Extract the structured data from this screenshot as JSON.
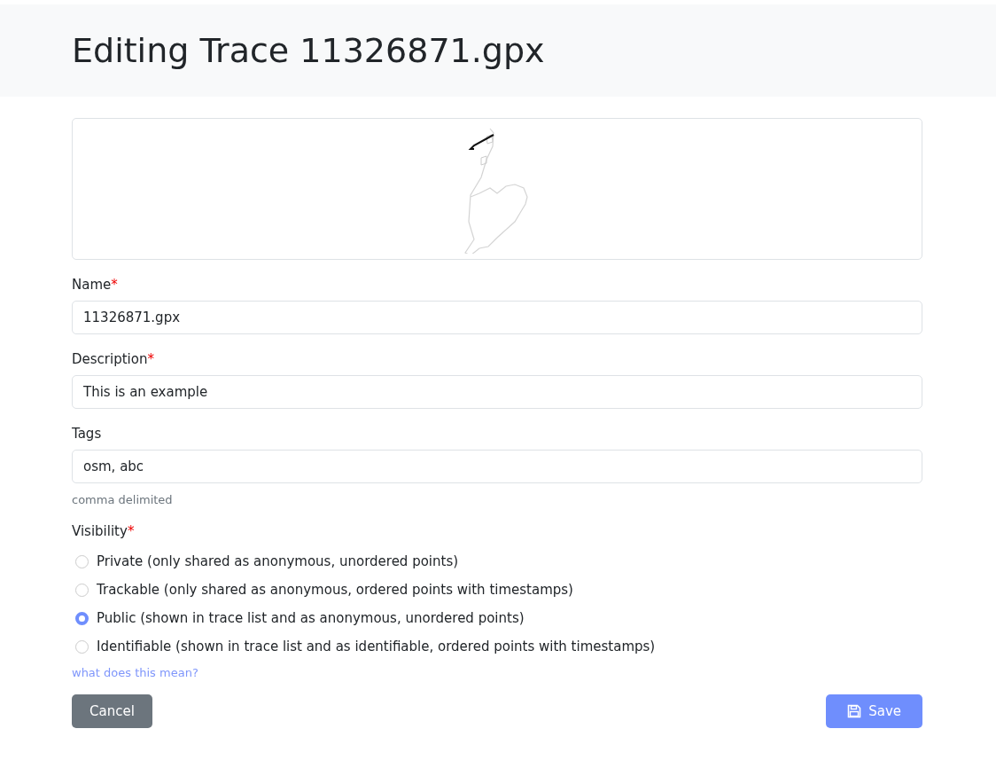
{
  "title": "Editing Trace 11326871.gpx",
  "fields": [
    {
      "label": "Name",
      "required_mark": "*",
      "value": "11326871.gpx"
    },
    {
      "label": "Description",
      "required_mark": "*",
      "value": "This is an example"
    },
    {
      "label": "Tags",
      "value": "osm, abc",
      "help": "comma delimited"
    }
  ],
  "visibility": {
    "label": "Visibility",
    "required_mark": "*",
    "options": [
      {
        "label": "Private (only shared as anonymous, unordered points)",
        "selected": false
      },
      {
        "label": "Trackable (only shared as anonymous, ordered points with timestamps)",
        "selected": false
      },
      {
        "label": "Public (shown in trace list and as anonymous, unordered points)",
        "selected": true
      },
      {
        "label": "Identifiable (shown in trace list and as identifiable, ordered points with timestamps)",
        "selected": false
      }
    ],
    "link": "what does this mean?"
  },
  "buttons": {
    "cancel": "Cancel",
    "save": "Save"
  }
}
